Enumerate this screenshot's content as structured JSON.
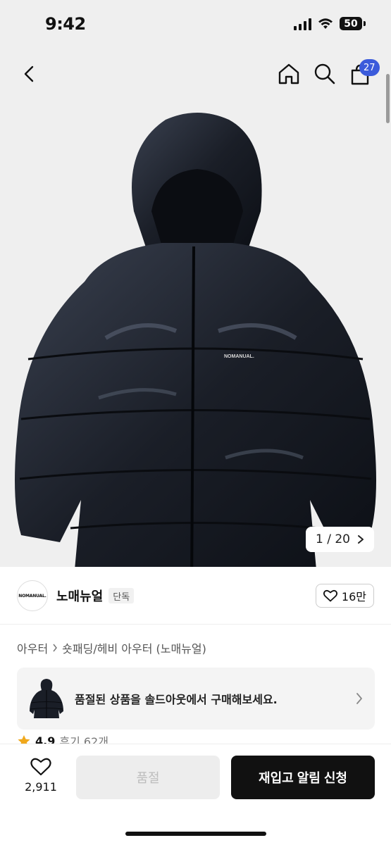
{
  "status_bar": {
    "time": "9:42",
    "battery": "50"
  },
  "nav": {
    "cart_count": "27"
  },
  "gallery": {
    "current": "1",
    "separator": " / ",
    "total": "20",
    "jacket_logo_text": "NOMANUAL."
  },
  "brand": {
    "logo_text": "NOMANUAL.",
    "name": "노매뉴얼",
    "badge": "단독",
    "likes": "16만"
  },
  "breadcrumb": {
    "category": "아우터",
    "subcategory": "숏패딩/헤비 아우터 (노매뉴얼)"
  },
  "soldout_banner": {
    "text": "품절된 상품을 솔드아웃에서 구매해보세요."
  },
  "rating": {
    "score": "4.9",
    "reviews": "후기 62개"
  },
  "bottom_bar": {
    "wish_count": "2,911",
    "soldout_label": "품절",
    "restock_label": "재입고 알림 신청"
  },
  "colors": {
    "accent_badge": "#3b5bdb",
    "primary_button": "#111111",
    "disabled_button": "#ededed"
  },
  "icons": [
    "back-arrow-icon",
    "home-icon",
    "search-icon",
    "cart-icon",
    "chevron-right-icon",
    "heart-icon",
    "star-icon"
  ]
}
